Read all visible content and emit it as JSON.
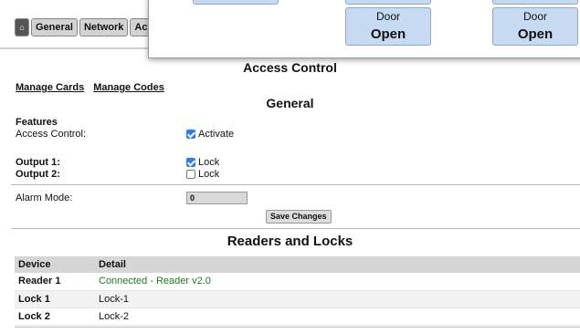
{
  "nav": {
    "tabs": [
      "General",
      "Network",
      "Ac"
    ]
  },
  "popup": {
    "doors": [
      {
        "label": "Door",
        "state": "Open"
      },
      {
        "label": "Door",
        "state": "Open"
      }
    ]
  },
  "access_control": {
    "title": "Access Control",
    "manage_cards": "Manage Cards",
    "manage_codes": "Manage Codes"
  },
  "general": {
    "title": "General",
    "features_heading": "Features",
    "access_control_label": "Access Control:",
    "access_control_option": "Activate",
    "access_control_checked": true,
    "output1_label": "Output 1:",
    "output1_option": "Lock",
    "output1_checked": true,
    "output2_label": "Output 2:",
    "output2_option": "Lock",
    "output2_checked": false,
    "alarm_mode_label": "Alarm Mode:",
    "alarm_mode_value": "0",
    "save_label": "Save Changes"
  },
  "readers": {
    "title": "Readers and Locks",
    "columns": [
      "Device",
      "Detail"
    ],
    "rows": [
      {
        "device": "Reader 1",
        "detail": "Connected - Reader v2.0"
      },
      {
        "device": "Lock 1",
        "detail": "Lock-1"
      },
      {
        "device": "Lock 2",
        "detail": "Lock-2"
      }
    ]
  },
  "colors": {
    "connected": "#1e7d1e",
    "checkbox": "#2d7ee6",
    "door_button": "#c6daf1"
  }
}
